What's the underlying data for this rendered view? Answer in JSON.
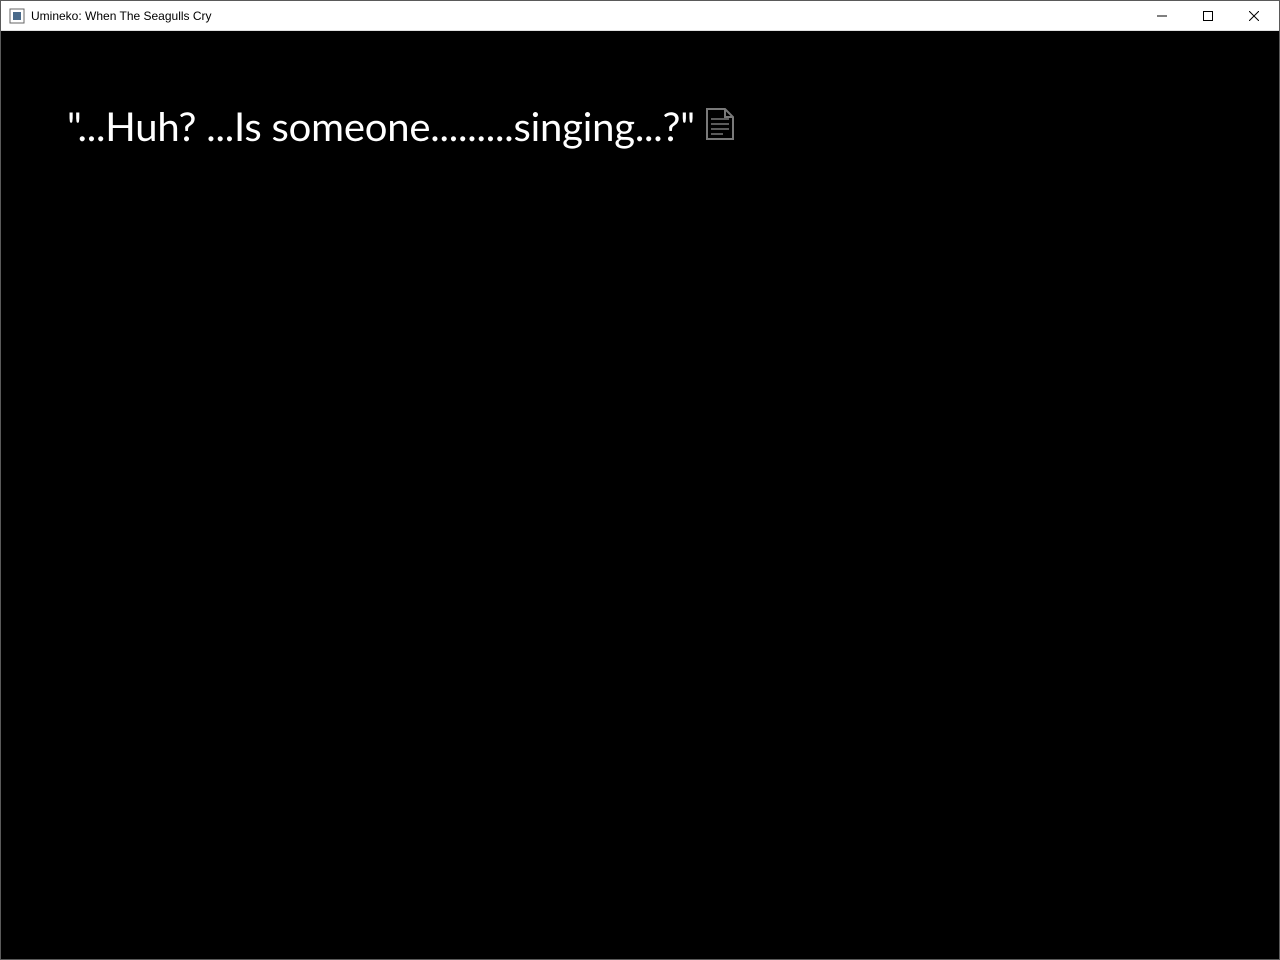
{
  "window": {
    "title": "Umineko: When The Seagulls Cry"
  },
  "dialogue": {
    "text": "\"...Huh?  ...Is someone.........singing...?\""
  }
}
